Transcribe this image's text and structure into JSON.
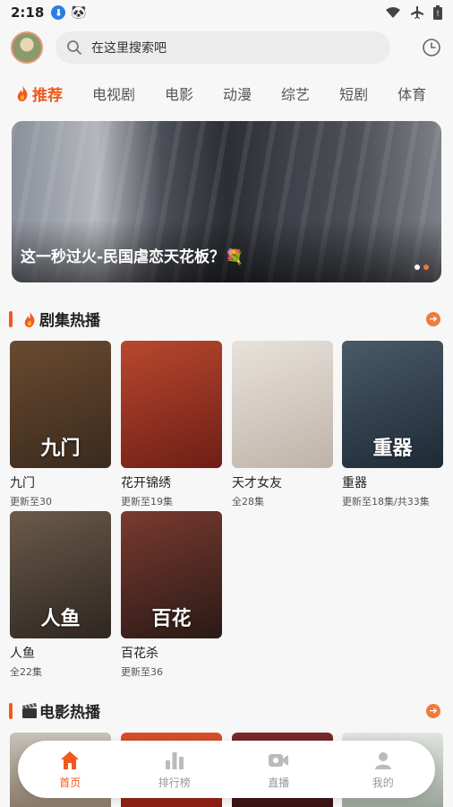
{
  "status_bar": {
    "time": "2:18",
    "download_glyph": "⬇",
    "pet_glyph": "🐼"
  },
  "header": {
    "search_placeholder": "在这里搜索吧"
  },
  "tabs": [
    {
      "label": "推荐",
      "active": true
    },
    {
      "label": "电视剧",
      "active": false
    },
    {
      "label": "电影",
      "active": false
    },
    {
      "label": "动漫",
      "active": false
    },
    {
      "label": "综艺",
      "active": false
    },
    {
      "label": "短剧",
      "active": false
    },
    {
      "label": "体育",
      "active": false
    }
  ],
  "banner": {
    "caption": "这一秒过火-民国虐恋天花板？💐",
    "page_count": 2,
    "current_page": 2
  },
  "sections": {
    "series": {
      "title": "剧集热播",
      "items": [
        {
          "name": "九门",
          "sub": "更新至30",
          "overlay": "九门",
          "colors": [
            "#6a4a30",
            "#3a2a1e"
          ]
        },
        {
          "name": "花开锦绣",
          "sub": "更新至19集",
          "overlay": "",
          "colors": [
            "#b8482e",
            "#6e1e16"
          ]
        },
        {
          "name": "天才女友",
          "sub": "全28集",
          "overlay": "",
          "colors": [
            "#e8e2dc",
            "#bfb3a8"
          ]
        },
        {
          "name": "重器",
          "sub": "更新至18集/共33集",
          "overlay": "重器",
          "colors": [
            "#4a5a68",
            "#1e2a36"
          ]
        },
        {
          "name": "人鱼",
          "sub": "全22集",
          "overlay": "人鱼",
          "colors": [
            "#6a5a4a",
            "#2e2620"
          ]
        },
        {
          "name": "百花杀",
          "sub": "更新至36",
          "overlay": "百花",
          "colors": [
            "#7a3a30",
            "#2a1a16"
          ]
        }
      ]
    },
    "movies": {
      "title": "电影热播"
    }
  },
  "bottom_nav": [
    {
      "label": "首页",
      "icon": "home-icon",
      "active": true
    },
    {
      "label": "排行榜",
      "icon": "ranking-icon",
      "active": false
    },
    {
      "label": "直播",
      "icon": "live-icon",
      "active": false
    },
    {
      "label": "我的",
      "icon": "profile-icon",
      "active": false
    }
  ],
  "colors": {
    "accent": "#f05a1e",
    "background": "#f7f7f7"
  }
}
